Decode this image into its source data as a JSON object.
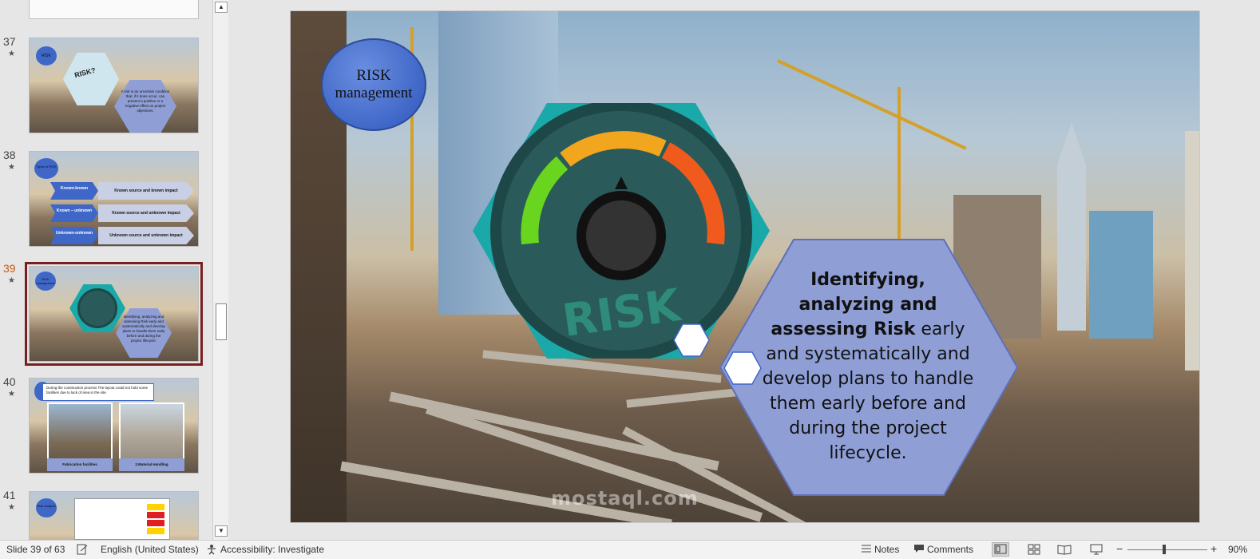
{
  "thumbnails": [
    {
      "number": "37",
      "slide": {
        "circle_label": "RISK",
        "hex_label": "RISK?",
        "body": "A risk is an uncertain condition that, if it does occur, can present a positive or a negative effect on project objectives."
      }
    },
    {
      "number": "38",
      "slide": {
        "circle_label": "Types of RISK",
        "rows": [
          {
            "tag": "Known-known",
            "desc": "Known source and known impact"
          },
          {
            "tag": "Known – unknown",
            "desc": "Known source and unknown impact"
          },
          {
            "tag": "Unknown-unknown",
            "desc": "Unknown source and unknown impact"
          }
        ]
      }
    },
    {
      "number": "39",
      "slide": {
        "circle_label": "RISK management",
        "body": "Identifying, analyzing and assessing Risk early and systematically and develop plans to handle them early before and during the project lifecycle."
      }
    },
    {
      "number": "40",
      "slide": {
        "header": "During the construction process The layout could not hold some facilities due to lack of area in the site",
        "caption_left": "Fabrication facilities",
        "caption_right": "2.Material Handling"
      }
    },
    {
      "number": "41",
      "slide": {
        "circle_label": "Risk analysis"
      }
    }
  ],
  "active_thumbnail_index": 2,
  "main_slide": {
    "circle_label": "RISK management",
    "gauge_word": "RISK",
    "info_bold": "Identifying, analyzing and assessing Risk",
    "info_rest": "early and systematically and develop plans to handle them early before and during the project lifecycle.",
    "watermark": "mostaql.com"
  },
  "status_bar": {
    "slide_indicator": "Slide 39 of 63",
    "language": "English (United States)",
    "accessibility": "Accessibility: Investigate",
    "notes": "Notes",
    "comments": "Comments",
    "zoom_minus": "−",
    "zoom_plus": "+",
    "zoom_level": "90%"
  },
  "colors": {
    "accent_red": "#7a1f1f",
    "gauge_teal": "#1aa8a8",
    "gauge_dark": "#2a5a5a",
    "info_hex_fill": "#8f9fd6",
    "circle_blue": "#3f67c7"
  }
}
